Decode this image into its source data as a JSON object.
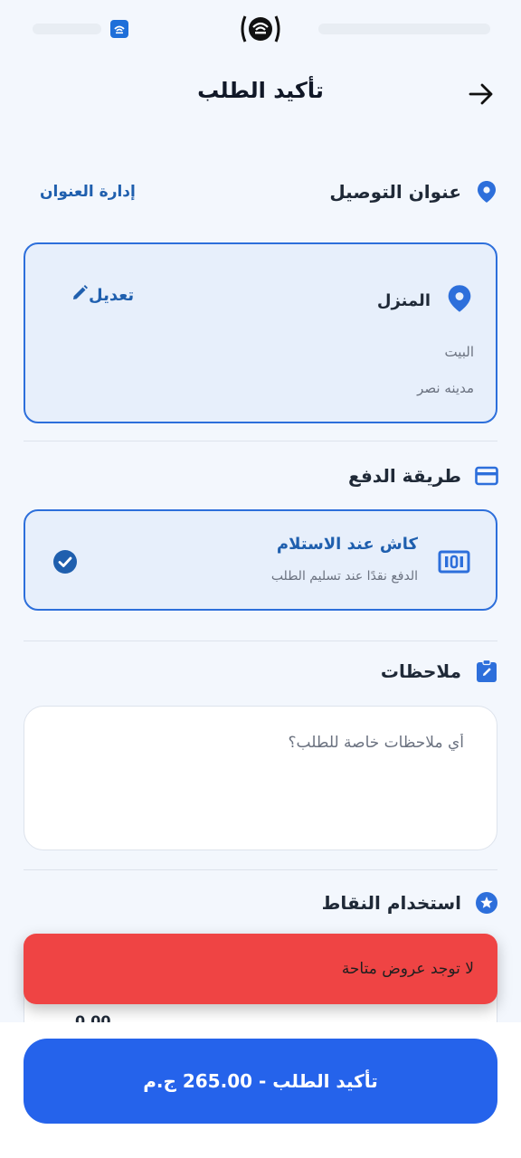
{
  "header": {
    "title": "تأكيد الطلب",
    "back_icon": "arrow-right-icon"
  },
  "delivery": {
    "title": "عنوان التوصيل",
    "manage_link": "إدارة العنوان",
    "icon": "location-pin-icon",
    "address": {
      "name": "المنزل",
      "edit_label": "تعديل",
      "line1": "البيت",
      "line2": "مدينه نصر"
    }
  },
  "payment": {
    "title": "طريقة الدفع",
    "icon": "credit-card-icon",
    "method": {
      "title": "كاش عند الاستلام",
      "subtitle": "الدفع نقدًا عند تسليم الطلب",
      "icon": "cash-icon",
      "selected": true
    }
  },
  "notes": {
    "title": "ملاحظات",
    "icon": "note-edit-icon",
    "placeholder": "أي ملاحظات خاصة للطلب؟",
    "value": ""
  },
  "points": {
    "title": "استخدام النقاط",
    "icon": "star-icon",
    "value": "0.00"
  },
  "toast": {
    "message": "لا توجد عروض متاحة"
  },
  "confirm": {
    "label": "تأكيد الطلب - 265.00 ج.م"
  },
  "colors": {
    "primary": "#2563eb",
    "link": "#1f5fae",
    "toast": "#ef4444",
    "background": "#f3f7fd"
  }
}
